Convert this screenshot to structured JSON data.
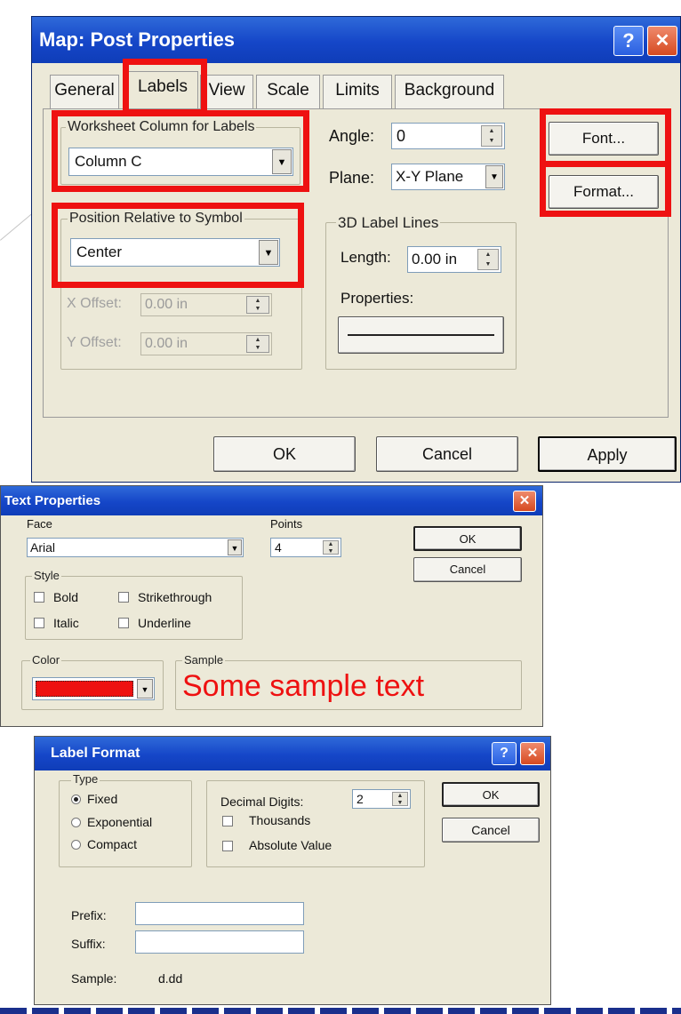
{
  "post_properties": {
    "title": "Map: Post Properties",
    "help_glyph": "?",
    "close_glyph": "✕",
    "tabs": [
      "General",
      "Labels",
      "View",
      "Scale",
      "Limits",
      "Background"
    ],
    "worksheet_column_label": "Worksheet Column for Labels",
    "worksheet_column_value": "Column C",
    "position_label": "Position Relative to Symbol",
    "position_value": "Center",
    "x_offset_label": "X Offset:",
    "x_offset_value": "0.00 in",
    "y_offset_label": "Y Offset:",
    "y_offset_value": "0.00 in",
    "angle_label": "Angle:",
    "angle_value": "0",
    "plane_label": "Plane:",
    "plane_value": "X-Y Plane",
    "label_lines_group": "3D Label Lines",
    "length_label": "Length:",
    "length_value": "0.00 in",
    "properties_label": "Properties:",
    "font_button": "Font...",
    "format_button": "Format...",
    "ok_button": "OK",
    "cancel_button": "Cancel",
    "apply_button": "Apply"
  },
  "text_properties": {
    "title": "Text Properties",
    "close_glyph": "✕",
    "face_label": "Face",
    "face_value": "Arial",
    "points_label": "Points",
    "points_value": "4",
    "ok_button": "OK",
    "cancel_button": "Cancel",
    "style_group": "Style",
    "bold": "Bold",
    "strikethrough": "Strikethrough",
    "italic": "Italic",
    "underline": "Underline",
    "color_group": "Color",
    "color_value": "#ee1111",
    "sample_group": "Sample",
    "sample_text": "Some sample text"
  },
  "label_format": {
    "title": "Label Format",
    "help_glyph": "?",
    "close_glyph": "✕",
    "type_group": "Type",
    "fixed": "Fixed",
    "exponential": "Exponential",
    "compact": "Compact",
    "decimal_digits_label": "Decimal Digits:",
    "decimal_digits_value": "2",
    "thousands": "Thousands",
    "absolute_value": "Absolute Value",
    "ok_button": "OK",
    "cancel_button": "Cancel",
    "prefix_label": "Prefix:",
    "suffix_label": "Suffix:",
    "sample_label": "Sample:",
    "sample_value": "d.dd"
  },
  "colors": {
    "highlight": "#ee1111",
    "title_bar": "#1546c8",
    "dialog_bg": "#ece9d8"
  }
}
